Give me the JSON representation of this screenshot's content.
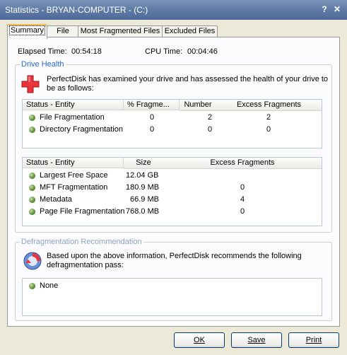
{
  "window": {
    "title": "Statistics - BRYAN-COMPUTER - (C:)",
    "help_btn": "?",
    "close_btn": "✕"
  },
  "tabs": [
    "Summary",
    "File",
    "Most Fragmented Files",
    "Excluded Files"
  ],
  "times": {
    "elapsed_label": "Elapsed Time:",
    "elapsed_value": "00:54:18",
    "cpu_label": "CPU Time:",
    "cpu_value": "00:04:46"
  },
  "drive_health": {
    "title": "Drive Health",
    "message_line1": "PerfectDisk has examined your drive and has assessed the health of your drive to",
    "message_line2": "be as follows:",
    "table1": {
      "headers": [
        "Status - Entity",
        "% Fragme...",
        "Number",
        "Excess Fragments"
      ],
      "rows": [
        {
          "entity": "File Fragmentation",
          "pct": "0",
          "number": "2",
          "excess": "2"
        },
        {
          "entity": "Directory Fragmentation",
          "pct": "0",
          "number": "0",
          "excess": "0"
        }
      ]
    },
    "table2": {
      "headers": [
        "Status - Entity",
        "Size",
        "Excess Fragments"
      ],
      "rows": [
        {
          "entity": "Largest Free Space",
          "size": "12.04 GB",
          "excess": ""
        },
        {
          "entity": "MFT Fragmentation",
          "size": "180.9 MB",
          "excess": "0"
        },
        {
          "entity": "Metadata",
          "size": "66.9 MB",
          "excess": "4"
        },
        {
          "entity": "Page File Fragmentation",
          "size": "768.0 MB",
          "excess": "0"
        }
      ]
    }
  },
  "recommendation": {
    "title": "Defragmentation Recommendation",
    "line1": "Based upon the above information, PerfectDisk recommends the following",
    "line2": "defragmentation pass:",
    "items": [
      "None"
    ]
  },
  "buttons": {
    "ok": "OK",
    "save": "Save",
    "print": "Print"
  }
}
